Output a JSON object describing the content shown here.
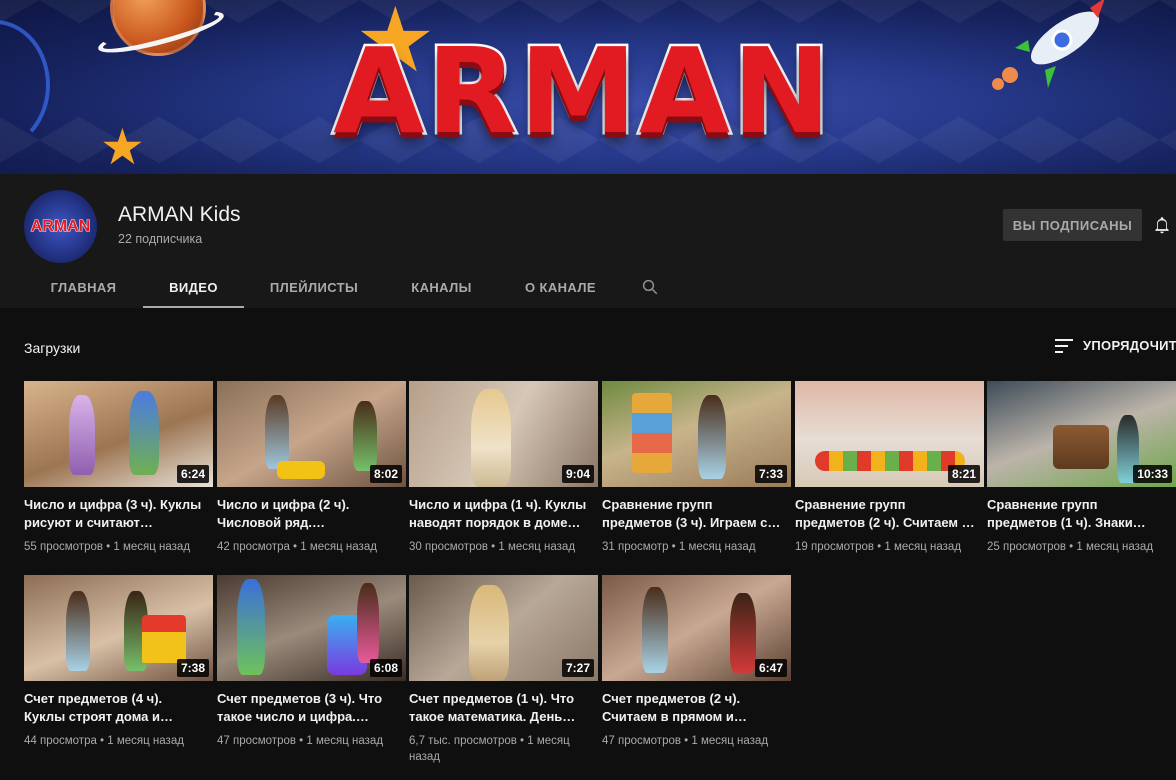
{
  "banner": {
    "title": "ARMAN"
  },
  "channel": {
    "avatar_text": "ARMAN",
    "name": "ARMAN Kids",
    "subscribers": "22 подписчика",
    "subscribed_label": "ВЫ ПОДПИСАНЫ"
  },
  "tabs": [
    {
      "label": "ГЛАВНАЯ"
    },
    {
      "label": "ВИДЕО"
    },
    {
      "label": "ПЛЕЙЛИСТЫ"
    },
    {
      "label": "КАНАЛЫ"
    },
    {
      "label": "О КАНАЛЕ"
    }
  ],
  "section": {
    "title": "Загрузки",
    "sort_label": "УПОРЯДОЧИТЬ"
  },
  "videos": [
    {
      "duration": "6:24",
      "title": "Число и цифра (3 ч). Куклы рисуют и считают…",
      "meta": "55 просмотров • 1 месяц назад"
    },
    {
      "duration": "8:02",
      "title": "Число и цифра (2 ч). Числовой ряд.…",
      "meta": "42 просмотра • 1 месяц назад"
    },
    {
      "duration": "9:04",
      "title": "Число и цифра (1 ч). Куклы наводят порядок в доме и…",
      "meta": "30 просмотров • 1 месяц назад"
    },
    {
      "duration": "7:33",
      "title": "Сравнение групп предметов (3 ч). Играем с…",
      "meta": "31 просмотр • 1 месяц назад"
    },
    {
      "duration": "8:21",
      "title": "Сравнение групп предметов (2 ч). Считаем …",
      "meta": "19 просмотров • 1 месяц назад"
    },
    {
      "duration": "10:33",
      "title": "Сравнение групп предметов (1 ч). Знаки…",
      "meta": "25 просмотров • 1 месяц назад"
    },
    {
      "duration": "7:38",
      "title": "Счет предметов (4 ч). Куклы строят дома и…",
      "meta": "44 просмотра • 1 месяц назад"
    },
    {
      "duration": "6:08",
      "title": "Счет предметов (3 ч). Что такое число и цифра.…",
      "meta": "47 просмотров • 1 месяц назад"
    },
    {
      "duration": "7:27",
      "title": "Счет предметов (1 ч). Что такое математика. День…",
      "meta": "6,7 тыс. просмотров • 1 месяц назад"
    },
    {
      "duration": "6:47",
      "title": "Счет предметов (2 ч). Считаем в прямом и…",
      "meta": "47 просмотров • 1 месяц назад"
    }
  ],
  "colors": {
    "background": "#0f0f0f",
    "header": "#181818",
    "text": "#f1f1f1",
    "secondary": "#aaaaaa",
    "subscribed_bg": "#333333",
    "brand_red": "#e21b23"
  }
}
